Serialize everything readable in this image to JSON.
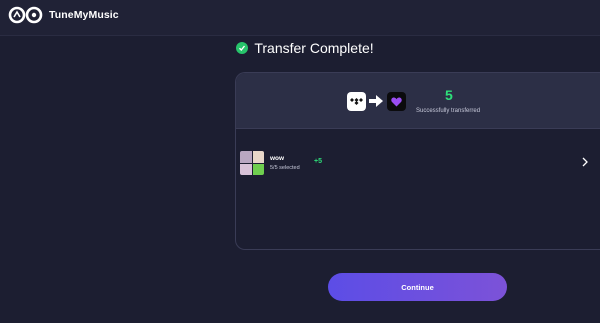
{
  "app": {
    "name": "TuneMyMusic"
  },
  "status": {
    "title": "Transfer Complete!"
  },
  "summary": {
    "count": "5",
    "count_label": "Successfully transferred",
    "source_icon": "tidal-icon",
    "destination_icon": "heart-music-icon"
  },
  "playlists": [
    {
      "name": "wow",
      "selected": "5/5 selected",
      "added": "+5"
    }
  ],
  "actions": {
    "continue_label": "Continue"
  },
  "colors": {
    "background": "#1c1e31",
    "success": "#2ee07a",
    "button_start": "#5c4de6",
    "button_end": "#7c52d8"
  }
}
